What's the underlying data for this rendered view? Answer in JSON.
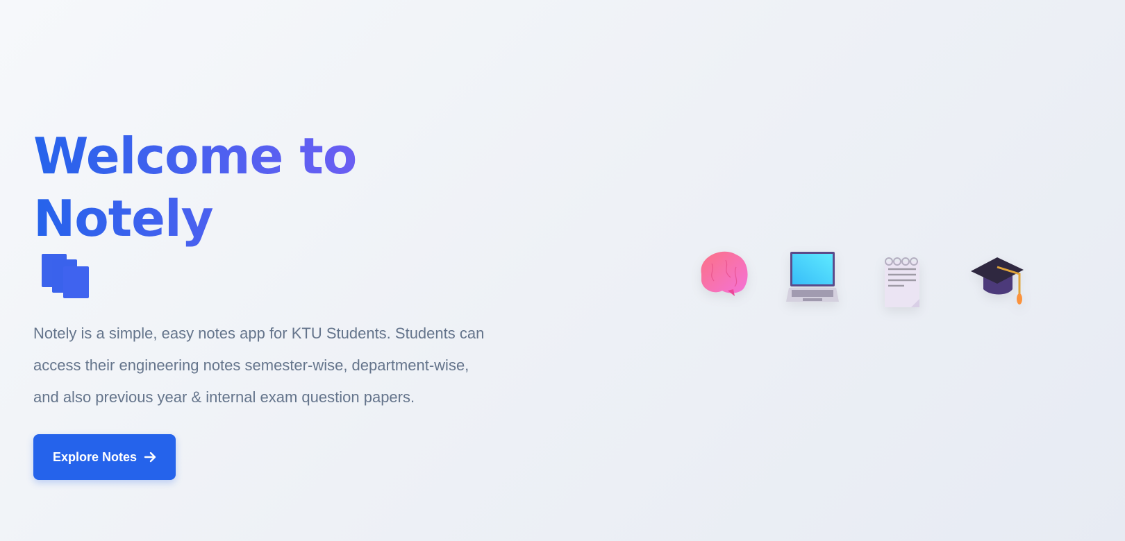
{
  "hero": {
    "title": "Welcome to Notely",
    "title_icon": "stacked-pages-icon",
    "description": "Notely is a simple, easy notes app for KTU Students. Students can access their engineering notes semester-wise, department-wise, and also previous year & internal exam question papers.",
    "cta_label": "Explore Notes",
    "cta_icon": "arrow-right-icon"
  },
  "illustrations": [
    "brain-icon",
    "laptop-icon",
    "notepad-icon",
    "graduation-cap-icon"
  ],
  "colors": {
    "accent": "#2563eb",
    "gradient_end": "#8b5cf6",
    "text_muted": "#64748b"
  }
}
